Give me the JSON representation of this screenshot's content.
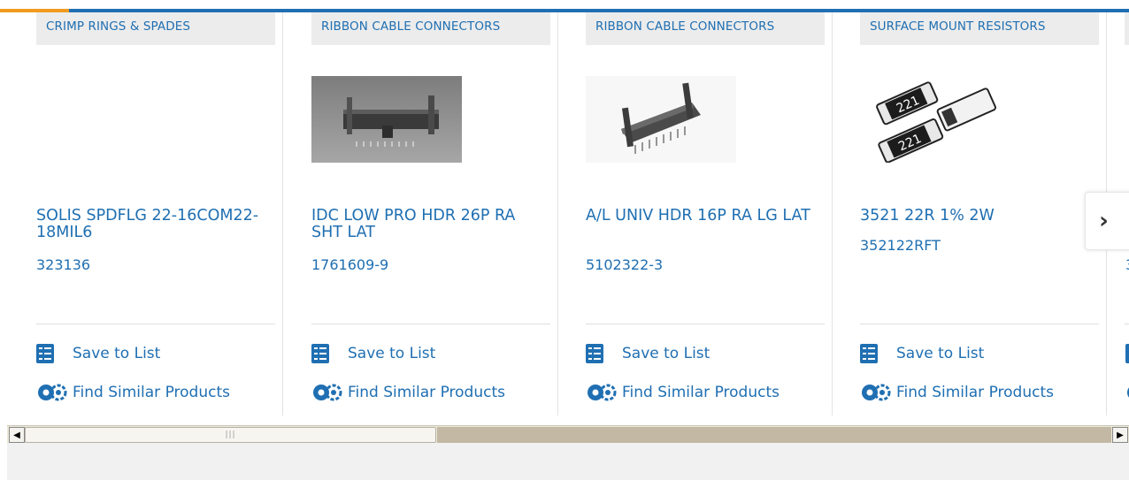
{
  "cards": [
    {
      "category": "CRIMP RINGS & SPADES",
      "title": "SOLIS SPDFLG 22-16COM22-18MIL6",
      "part_number": "323136",
      "save_label": "Save to List",
      "similar_label": "Find Similar Products",
      "image": "none"
    },
    {
      "category": "RIBBON CABLE CONNECTORS",
      "title": "IDC LOW PRO HDR 26P RA SHT LAT",
      "part_number": "1761609-9",
      "save_label": "Save to List",
      "similar_label": "Find Similar Products",
      "image": "ribbon-header-photo"
    },
    {
      "category": "RIBBON CABLE CONNECTORS",
      "title": "A/L UNIV HDR 16P RA LG LAT",
      "part_number": "5102322-3",
      "save_label": "Save to List",
      "similar_label": "Find Similar Products",
      "image": "latched-header-photo"
    },
    {
      "category": "SURFACE MOUNT RESISTORS",
      "title": "3521 22R 1% 2W",
      "part_number": "352122RFT",
      "save_label": "Save to List",
      "similar_label": "Find Similar Products",
      "image": "smd-resistor-photo"
    },
    {
      "category": "",
      "title": "",
      "part_number": "3",
      "save_label": "",
      "similar_label": "",
      "image": "none"
    }
  ],
  "resistor_marking": "221",
  "next_button": {
    "icon": "chevron-right-icon",
    "glyph": "›"
  },
  "scrollbar": {
    "left_glyph": "◀",
    "right_glyph": "▶",
    "grip": "|||",
    "position_fraction": 0.0
  },
  "colors": {
    "accent": "#1f6fb2",
    "orange": "#f29a1f",
    "category_bg": "#ececec"
  }
}
